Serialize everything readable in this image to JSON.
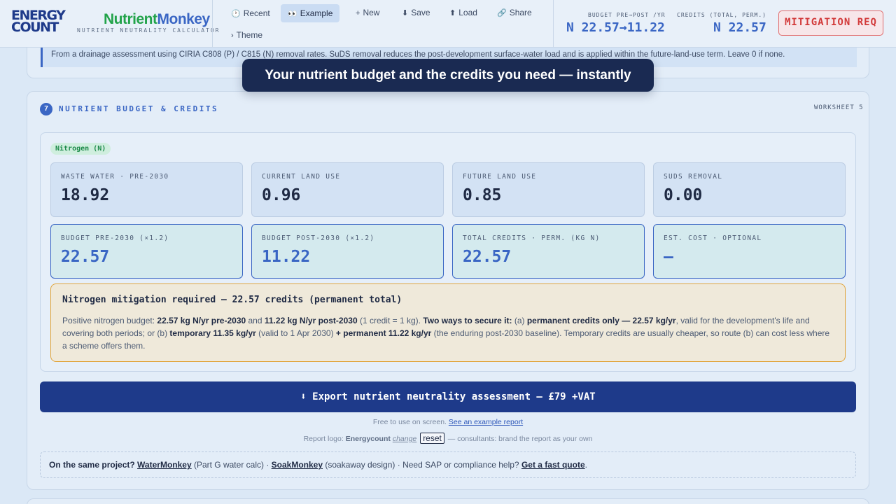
{
  "header": {
    "brand_line1": "ENERGY",
    "brand_line2": "COUNT",
    "app_name_a": "Nutrient",
    "app_name_b": "Monkey",
    "app_subtitle": "NUTRIENT NEUTRALITY CALCULATOR",
    "nav": [
      {
        "icon": "🕐",
        "label": "Recent"
      },
      {
        "icon": "👀",
        "label": "Example"
      },
      {
        "icon": "+",
        "label": "New"
      },
      {
        "icon": "⬇",
        "label": "Save"
      },
      {
        "icon": "⬆",
        "label": "Load"
      },
      {
        "icon": "🔗",
        "label": "Share"
      },
      {
        "icon": "›",
        "label": "Theme"
      }
    ],
    "budget_label": "BUDGET PRE→POST /YR",
    "budget_value": "N 22.57→11.22",
    "credits_label": "CREDITS (TOTAL, PERM.)",
    "credits_value": "N 22.57",
    "badge": "MITIGATION REQ"
  },
  "prev_note": "From a drainage assessment using CIRIA C808 (P) / C815 (N) removal rates. SuDS removal reduces the post-development surface-water load and is applied within the future-land-use term. Leave 0 if none.",
  "toast": "Your nutrient budget and the credits you need — instantly",
  "section": {
    "number": "7",
    "title": "NUTRIENT BUDGET & CREDITS",
    "worksheet": "WORKSHEET 5",
    "pill": "Nitrogen (N)"
  },
  "tiles_row1": [
    {
      "label": "WASTE WATER · PRE-2030",
      "value": "18.92"
    },
    {
      "label": "CURRENT LAND USE",
      "value": "0.96"
    },
    {
      "label": "FUTURE LAND USE",
      "value": "0.85"
    },
    {
      "label": "SUDS REMOVAL",
      "value": "0.00"
    }
  ],
  "tiles_row2": [
    {
      "label": "BUDGET PRE-2030 (×1.2)",
      "value": "22.57"
    },
    {
      "label": "BUDGET POST-2030 (×1.2)",
      "value": "11.22"
    },
    {
      "label": "TOTAL CREDITS · PERM. (KG N)",
      "value": "22.57"
    },
    {
      "label": "EST. COST · OPTIONAL",
      "value": "—"
    }
  ],
  "warning": {
    "title": "Nitrogen mitigation required — 22.57 credits (permanent total)",
    "t1": "Positive nitrogen budget: ",
    "b1": "22.57 kg N/yr pre-2030",
    "t2": " and ",
    "b2": "11.22 kg N/yr post-2030",
    "t3": " (1 credit = 1 kg). ",
    "b3": "Two ways to secure it:",
    "t4": " (a) ",
    "b4": "permanent credits only — 22.57 kg/yr",
    "t5": ", valid for the development's life and covering both periods; or (b) ",
    "b5": "temporary 11.35 kg/yr",
    "t6": " (valid to 1 Apr 2030) ",
    "b6": "+ permanent 11.22 kg/yr",
    "t7": " (the enduring post-2030 baseline). Temporary credits are usually cheaper, so route (b) can cost less where a scheme offers them."
  },
  "export_button": "⬇ Export nutrient neutrality assessment — £79 +VAT",
  "free_text": "Free to use on screen. ",
  "example_link": "See an example report",
  "logo_text": "Report logo: ",
  "logo_name": "Energycount",
  "change_link": "change",
  "reset_label": "reset",
  "logo_tail": "— consultants: brand the report as your own",
  "also": {
    "lead": "On the same project?",
    "water": "WaterMonkey",
    "water_tail": " (Part G water calc) · ",
    "soak": "SoakMonkey",
    "soak_tail": " (soakaway design) · Need SAP or compliance help? ",
    "quote": "Get a fast quote",
    "end": "."
  }
}
